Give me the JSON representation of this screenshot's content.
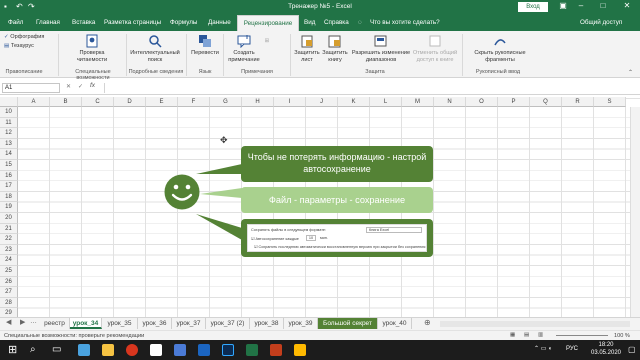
{
  "titlebar": {
    "title": "Тренажер №5  -  Excel",
    "login": "Вход"
  },
  "tabs": [
    "Файл",
    "Главная",
    "Вставка",
    "Разметка страницы",
    "Формулы",
    "Данные",
    "Рецензирование",
    "Вид",
    "Справка"
  ],
  "active_tab": "Рецензирование",
  "tellme": "Что вы хотите сделать?",
  "share": "Общий доступ",
  "ribbon": {
    "spelling": "Орфография",
    "thesaurus": "Тезаурус",
    "check_access": "Проверка читаемости",
    "smart_lookup": "Интеллектуальный поиск",
    "translate": "Перевести",
    "new_comment": "Создать примечание",
    "protect_sheet": "Защитить лист",
    "protect_book": "Защитить книгу",
    "allow_edit": "Разрешить изменение диапазонов",
    "unshare": "Отменить общий доступ к книге",
    "hide_ink": "Скрыть рукописные фрагменты"
  },
  "groups": [
    "Правописание",
    "Специальные возможности",
    "Подробные сведения",
    "Язык",
    "Примечания",
    "Защита",
    "Рукописный ввод"
  ],
  "namebox": "A1",
  "columns": [
    "A",
    "B",
    "C",
    "D",
    "E",
    "F",
    "G",
    "H",
    "I",
    "J",
    "K",
    "L",
    "M",
    "N",
    "O",
    "P",
    "Q",
    "R",
    "S"
  ],
  "rows": [
    "10",
    "11",
    "12",
    "13",
    "14",
    "15",
    "16",
    "17",
    "18",
    "19",
    "20",
    "21",
    "22",
    "23",
    "24",
    "25",
    "26",
    "27",
    "28",
    "29",
    "30"
  ],
  "callouts": {
    "c1": "Чтобы не потерять информацию - настрой автосохранение",
    "c2": "Файл - параметры - сохранение"
  },
  "options": {
    "save_format": "Сохранять файлы в следующем формате:",
    "format_val": "Книга Excel",
    "autosave": "Автосохранение каждые",
    "minutes": "10",
    "min_label": "мин.",
    "keep": "Сохранять последнюю автоматически восстановленную версию при закрытии без сохранения"
  },
  "sheets": [
    "реестр",
    "урок_34",
    "урок_35",
    "урок_36",
    "урок_37",
    "урок_37 (2)",
    "урок_38",
    "урок_39",
    "Большой секрет",
    "урок_40"
  ],
  "active_sheet": "урок_34",
  "accent_sheet": "Большой секрет",
  "status": "Специальные возможности: проверьте рекомендации",
  "zoom": "100 %",
  "clock": {
    "time": "18:20",
    "date": "03.05.2020"
  },
  "lang": "РУС",
  "colors": {
    "excel_green": "#217346",
    "callout_dark": "#548235",
    "callout_light": "#a9d18e"
  }
}
